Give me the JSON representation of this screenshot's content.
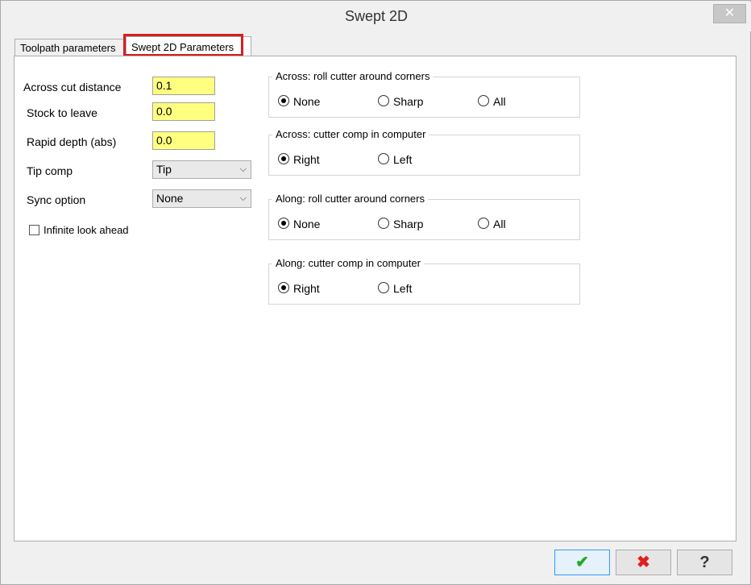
{
  "window": {
    "title": "Swept 2D",
    "close_glyph": "✕"
  },
  "tabs": [
    {
      "label": "Toolpath parameters",
      "active": false
    },
    {
      "label": "Swept 2D Parameters",
      "active": true
    }
  ],
  "form": {
    "across_cut_distance": {
      "label": "Across cut distance",
      "value": "0.1"
    },
    "stock_to_leave": {
      "label": "Stock to leave",
      "value": "0.0"
    },
    "rapid_depth": {
      "label": "Rapid depth (abs)",
      "value": "0.0"
    },
    "tip_comp": {
      "label": "Tip comp",
      "value": "Tip"
    },
    "sync_option": {
      "label": "Sync option",
      "value": "None"
    },
    "infinite_look_ahead": {
      "label": "Infinite look ahead",
      "checked": false
    }
  },
  "groups": [
    {
      "title": "Across: roll cutter around corners",
      "options": [
        {
          "label": "None",
          "checked": true
        },
        {
          "label": "Sharp",
          "checked": false
        },
        {
          "label": "All",
          "checked": false
        }
      ]
    },
    {
      "title": "Across: cutter comp in computer",
      "options": [
        {
          "label": "Right",
          "checked": true
        },
        {
          "label": "Left",
          "checked": false
        }
      ]
    },
    {
      "title": "Along: roll cutter around corners",
      "options": [
        {
          "label": "None",
          "checked": true
        },
        {
          "label": "Sharp",
          "checked": false
        },
        {
          "label": "All",
          "checked": false
        }
      ]
    },
    {
      "title": "Along: cutter comp in computer",
      "options": [
        {
          "label": "Right",
          "checked": true
        },
        {
          "label": "Left",
          "checked": false
        }
      ]
    }
  ],
  "buttons": {
    "ok": {
      "icon": "checkmark-icon",
      "glyph": "✔",
      "color": "#22aa22"
    },
    "cancel": {
      "icon": "x-icon",
      "glyph": "✖",
      "color": "#e02020"
    },
    "help": {
      "icon": "question-icon",
      "glyph": "?",
      "color": "#333333"
    }
  },
  "colors": {
    "highlight": "#d81e1e",
    "input_bg": "#ffff80"
  }
}
